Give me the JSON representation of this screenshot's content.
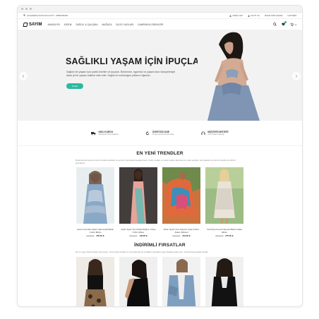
{
  "topbar": {
    "shipping_text": "ALIŞVERİŞ DOSYASI HATTI · 0850000000",
    "links": [
      "GİRİŞ YAP",
      "KAYIT OL",
      "BANKA BİLGİLERİ",
      "İLETİŞİM"
    ]
  },
  "brand": {
    "logo_text": "SAYIM"
  },
  "nav": {
    "items": [
      "ANASAYFA",
      "KİDEM",
      "SAĞLIK & ÇALIŞMA",
      "MAĞAZA",
      "BLOG YAZILARI",
      "KAMPANYA ÜRÜNLERİ"
    ],
    "cart_count": "0"
  },
  "hero": {
    "title": "SAĞLIKLI YAŞAM İÇİN İPUÇLARI",
    "desc": "Sağlıklı bir yaşam için pratik öneriler ve ipuçları. Beslenme, egzersiz ve yaşam tarzı tavsiyeleriyle daha iyi bir yaşam kalitesi elde edin. Sağlık ve mutluluğun yollarını öğrenin.",
    "button": "Keşfet"
  },
  "features": [
    {
      "icon": "truck-icon",
      "title": "HIZLI KARGO",
      "desc": "Siparişiniz hızla kargoda"
    },
    {
      "icon": "return-icon",
      "title": "ÜCRETSİZ İADE",
      "desc": "14 gün içinde ücretsiz iade"
    },
    {
      "icon": "headset-icon",
      "title": "MÜŞTERİ DESTEĞİ",
      "desc": "7/24 müşteri desteği"
    }
  ],
  "trends": {
    "title": "EN YENİ TRENDLER",
    "desc": "Moda dünyasında yeni sezon trendleri keşfedin ve tarzınızı yansıtacak parçaları bulun. Kadın modası ve erkek modası alanında öne çıkan parçalar, renk paletleri ve kombin önerileri ile stilinizi güncelleyin.",
    "products": [
      {
        "name": "Lacivert Gömlek Kapalı Yaka Çizgili Bahar Cotton Elbise",
        "old": "000,00 ₺",
        "new": "255,00 ₺"
      },
      {
        "name": "Kadın Siyah Yeni Modül Alttığımı Yahya Tehbır Elbise",
        "old": "000,00 ₺",
        "new": "149,00 ₺"
      },
      {
        "name": "Kadın Siyah Uzun Şekerler Çiçek Kolsuz Akşam Elbisesi",
        "old": "000,00 ₺",
        "new": "219,00 ₺"
      },
      {
        "name": "Tek Parça Kemerli Desenli Baskılı Salaş Elbise",
        "old": "000,00 ₺",
        "new": "275,00 ₺"
      }
    ]
  },
  "deals": {
    "title": "İNDİRİMLİ FIRSATLAR",
    "desc": "Şık ve uygun fiyatlı ürünleri kaçırmayın. Sınırlı süreli fırsatlar ve özel indirimler ile sevdiğiniz parçalara uygun fiyatlarla sahip olun. Güncel kampanyalar burada."
  },
  "colors": {
    "accent": "#2bb9a0"
  }
}
